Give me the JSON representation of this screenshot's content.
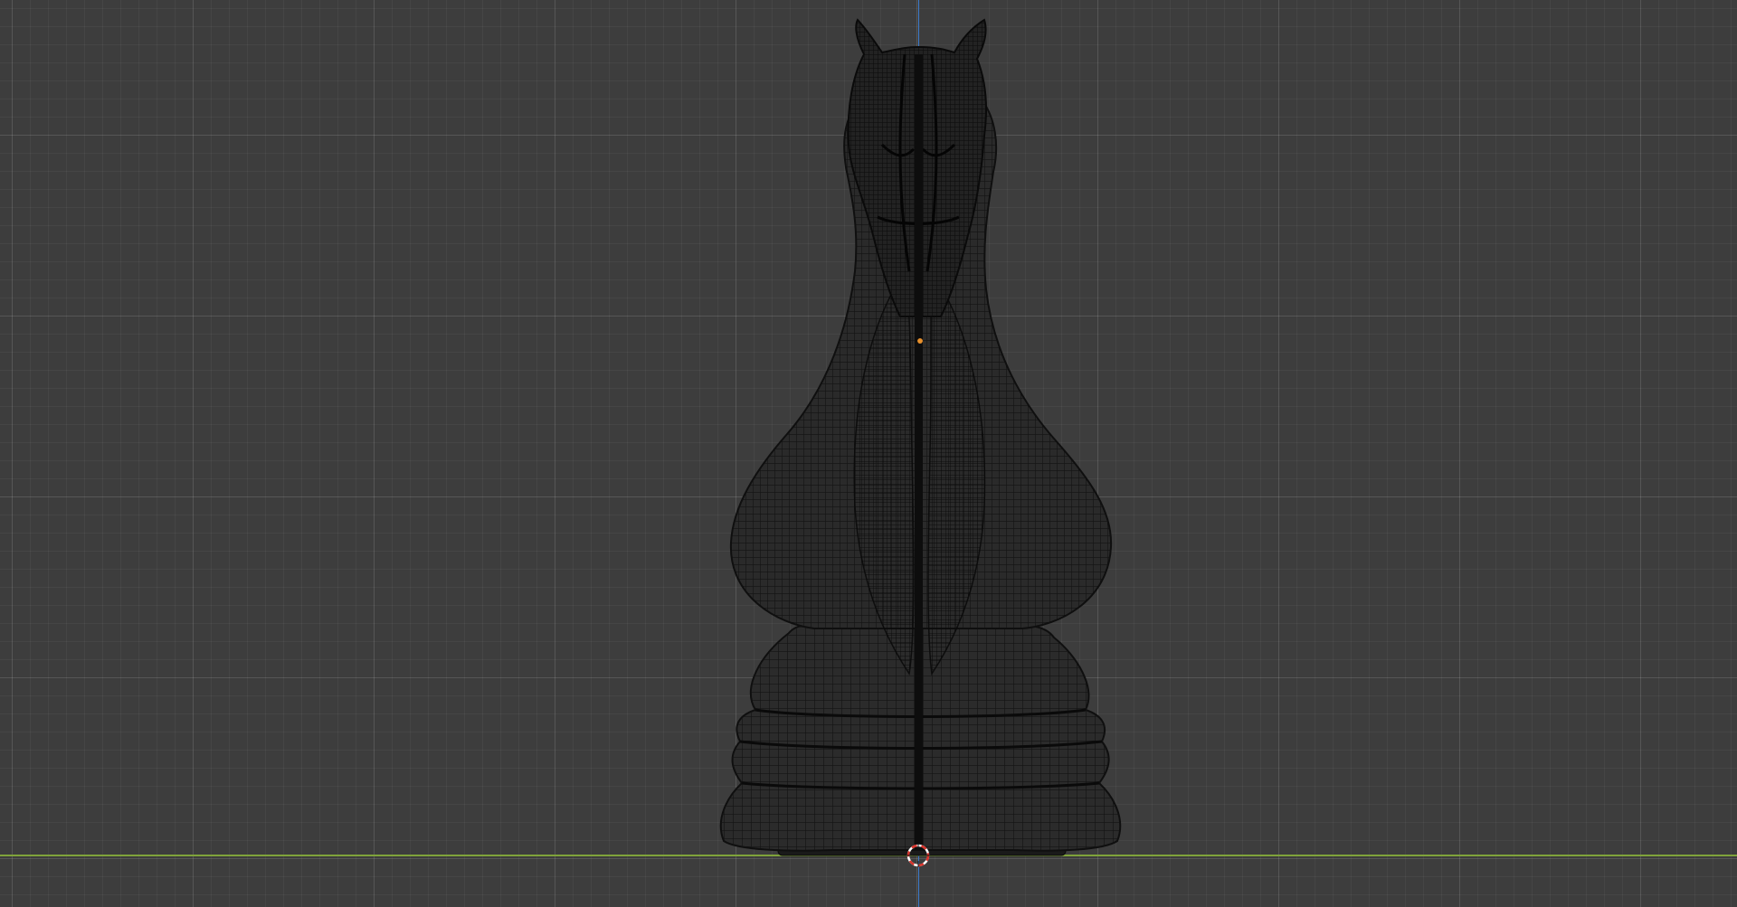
{
  "viewport": {
    "background_color": "#3d3d3d",
    "axis_x_color": "#7fa33a",
    "axis_y_color": "#3d7bcc",
    "mesh_color": "#0f0f0f",
    "origin_color": "#e8902c",
    "cursor_colors": [
      "#d8322a",
      "#ffffff"
    ],
    "icons": {
      "cursor": "3d-cursor-icon",
      "origin": "object-origin-icon"
    }
  }
}
